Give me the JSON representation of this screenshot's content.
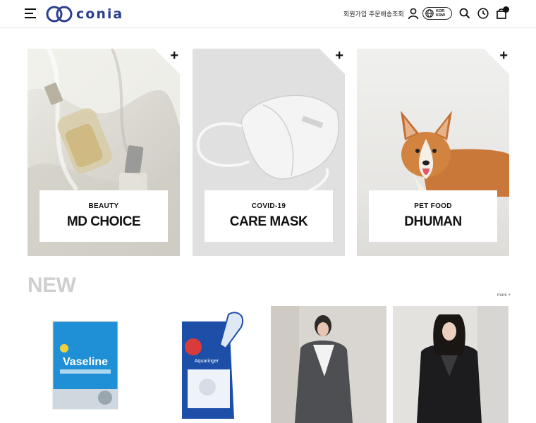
{
  "header": {
    "logo_text": "conia",
    "link_join": "회원가입",
    "link_order": "주문배송조회",
    "lang_line1": "KOR",
    "lang_line2": "KRW"
  },
  "categories": [
    {
      "small": "BEAUTY",
      "big": "MD CHOICE",
      "plus": "+"
    },
    {
      "small": "COVID-19",
      "big": "CARE MASK",
      "plus": "+"
    },
    {
      "small": "PET FOOD",
      "big": "DHUMAN",
      "plus": "+"
    }
  ],
  "new_section": {
    "title": "NEW",
    "more": "more +",
    "products": [
      {
        "brand_text": "Vaseline"
      },
      {
        "brand_text": "Aquaringer"
      },
      {
        "brand_text": ""
      },
      {
        "brand_text": ""
      }
    ]
  },
  "colors": {
    "logo_blue": "#2c3e8f",
    "vaseline_blue": "#1f8fd6",
    "mask_blue": "#1d4fa8"
  }
}
